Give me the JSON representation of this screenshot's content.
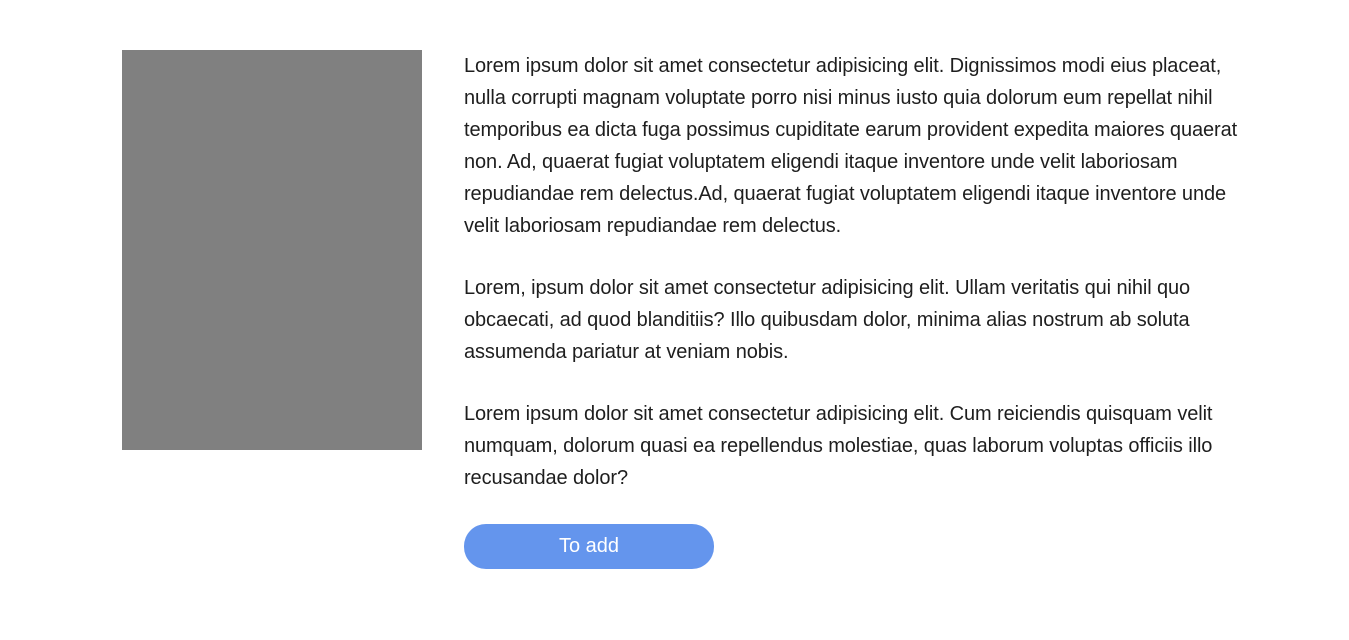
{
  "product": {
    "paragraphs": [
      "Lorem ipsum dolor sit amet consectetur adipisicing elit. Dignissimos modi eius placeat, nulla corrupti magnam voluptate porro nisi minus iusto quia dolorum eum repellat nihil temporibus ea dicta fuga possimus cupiditate earum provident expedita maiores quaerat non. Ad, quaerat fugiat voluptatem eligendi itaque inventore unde velit laboriosam repudiandae rem delectus.Ad, quaerat fugiat voluptatem eligendi itaque inventore unde velit laboriosam repudiandae rem delectus.",
      "Lorem, ipsum dolor sit amet consectetur adipisicing elit. Ullam veritatis qui nihil quo obcaecati, ad quod blanditiis? Illo quibusdam dolor, minima alias nostrum ab soluta assumenda pariatur at veniam nobis.",
      "Lorem ipsum dolor sit amet consectetur adipisicing elit. Cum reiciendis quisquam velit numquam, dolorum quasi ea repellendus molestiae, quas laborum voluptas officiis illo recusandae dolor?"
    ],
    "add_button_label": "To add",
    "image_placeholder_color": "#808080",
    "button_color": "#6495ed"
  }
}
